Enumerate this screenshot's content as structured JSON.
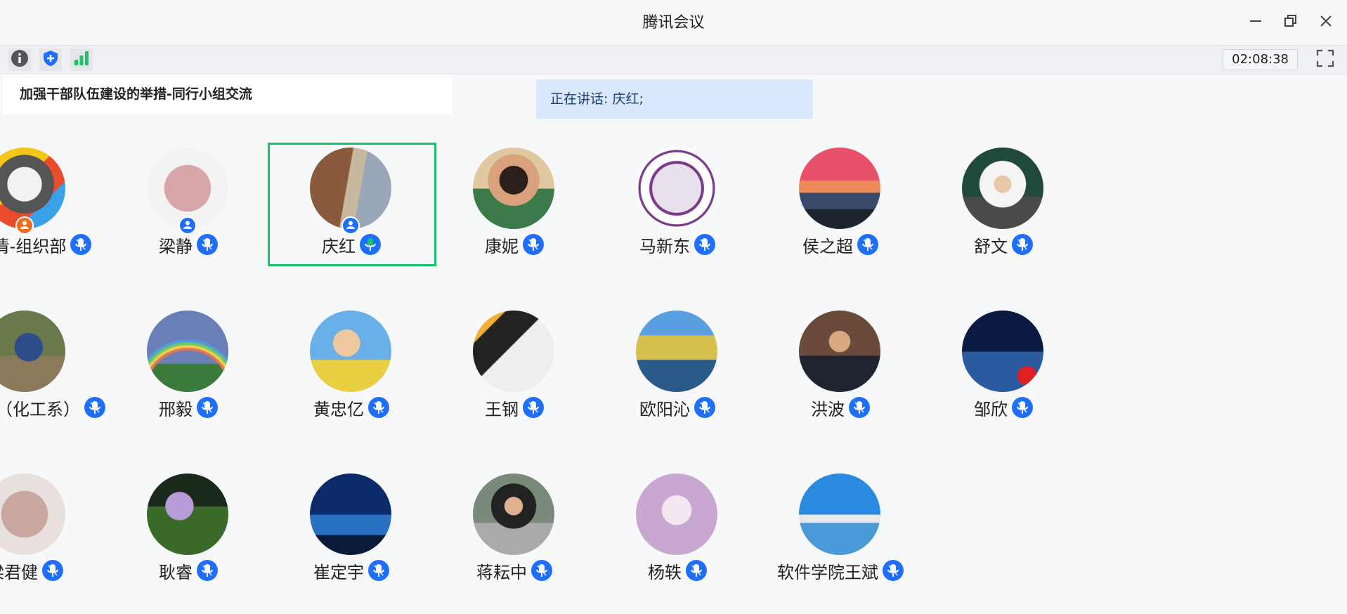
{
  "window": {
    "title": "腾讯会议"
  },
  "toolbar": {
    "timer": "02:08:38"
  },
  "meeting": {
    "topic": "加强干部队伍建设的举措-同行小组交流",
    "speaking_label": "正在讲话: 庆红;"
  },
  "colors": {
    "mic_blue": "#1e6fff",
    "active_border": "#18c36a",
    "host_orange": "#f26b1d"
  },
  "participants": [
    {
      "name": "冀冰清-组织部",
      "avatar": "cartoon-bird-avatar",
      "host": true
    },
    {
      "name": "梁静",
      "avatar": "pink-house-avatar",
      "cohost": true
    },
    {
      "name": "庆红",
      "avatar": "building-avatar",
      "cohost": true,
      "speaking": true
    },
    {
      "name": "康妮",
      "avatar": "family-photo-avatar"
    },
    {
      "name": "马新东",
      "avatar": "university-seal-avatar"
    },
    {
      "name": "侯之超",
      "avatar": "sunset-coast-avatar"
    },
    {
      "name": "舒文",
      "avatar": "classroom-photo-avatar"
    },
    {
      "name": "王铁峰（化工系）",
      "avatar": "reading-person-avatar"
    },
    {
      "name": "邢毅",
      "avatar": "rainbow-avatar"
    },
    {
      "name": "黄忠亿",
      "avatar": "cartoon-man-avatar"
    },
    {
      "name": "王钢",
      "avatar": "fountain-pen-avatar"
    },
    {
      "name": "欧阳沁",
      "avatar": "autumn-lake-avatar"
    },
    {
      "name": "洪波",
      "avatar": "man-suit-avatar"
    },
    {
      "name": "邹欣",
      "avatar": "starry-sky-flag-avatar"
    },
    {
      "name": "梁君健",
      "avatar": "pixelated-avatar"
    },
    {
      "name": "耿睿",
      "avatar": "purple-flowers-avatar"
    },
    {
      "name": "崔定宇",
      "avatar": "airplane-avatar"
    },
    {
      "name": "蒋耘中",
      "avatar": "man-sitting-avatar"
    },
    {
      "name": "杨轶",
      "avatar": "sketch-portrait-avatar"
    },
    {
      "name": "软件学院王斌",
      "avatar": "blue-sky-building-avatar"
    }
  ]
}
